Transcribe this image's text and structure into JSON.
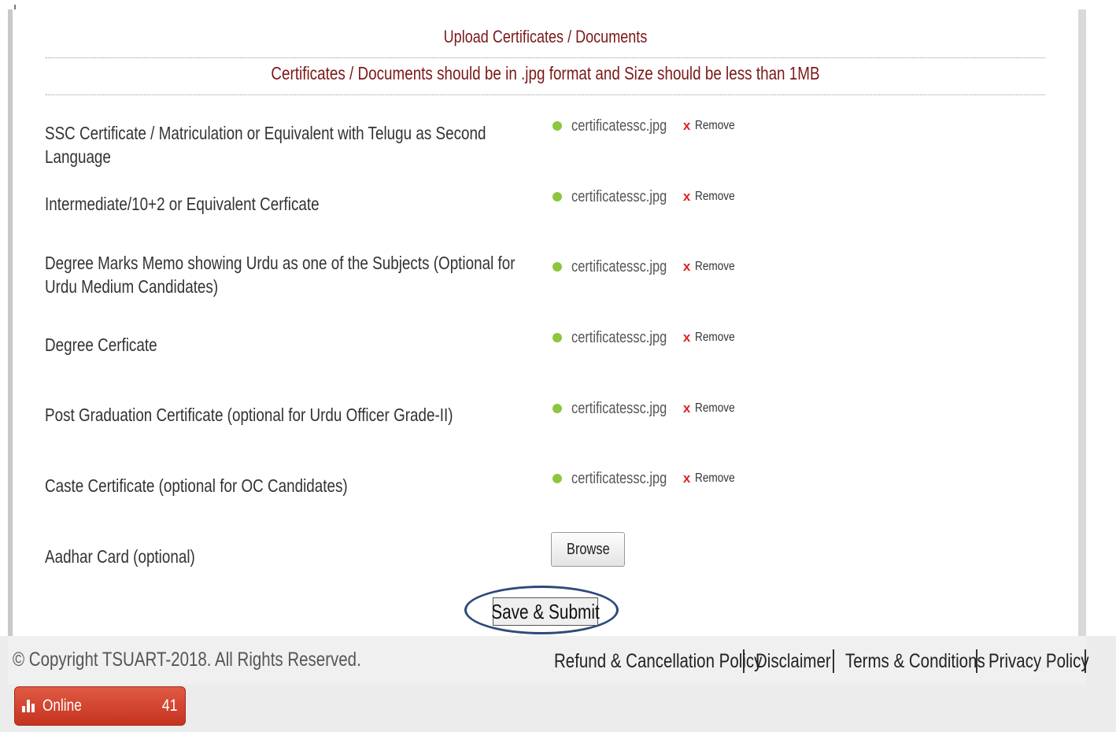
{
  "panel": {
    "title": "Upload Certificates / Documents",
    "notice": "Certificates / Documents should be in .jpg format and Size should be less than 1MB"
  },
  "documents": [
    {
      "label": "SSC Certificate / Matriculation or Equivalent with Telugu as Second Language",
      "file": "certificatessc.jpg",
      "remove": "Remove"
    },
    {
      "label": "Intermediate/10+2 or Equivalent Cerficate",
      "file": "certificatessc.jpg",
      "remove": "Remove"
    },
    {
      "label": "Degree Marks Memo showing Urdu as one of the Subjects (Optional for Urdu Medium Candidates)",
      "file": "certificatessc.jpg",
      "remove": "Remove"
    },
    {
      "label": "Degree Cerficate",
      "file": "certificatessc.jpg",
      "remove": "Remove"
    },
    {
      "label": "Post Graduation Certificate (optional for Urdu Officer Grade-II)",
      "file": "certificatessc.jpg",
      "remove": "Remove"
    },
    {
      "label": "Caste Certificate (optional for OC Candidates)",
      "file": "certificatessc.jpg",
      "remove": "Remove"
    },
    {
      "label": "Aadhar Card (optional)",
      "browse": "Browse"
    }
  ],
  "actions": {
    "submit_label": "Save & Submit"
  },
  "footer": {
    "copyright": "© Copyright TSUART-2018. All Rights Reserved.",
    "links": [
      "Refund & Cancellation Policy",
      "Disclaimer",
      "Terms & Conditions",
      "Privacy Policy"
    ]
  },
  "online_widget": {
    "label": "Online",
    "count": "41",
    "icon": "bar-chart-icon"
  },
  "colors": {
    "heading": "#7b1818",
    "status_dot": "#8cc63f",
    "remove_x": "#e02020",
    "highlight_ring": "#2d4a7a",
    "online_badge": "#c43320"
  }
}
